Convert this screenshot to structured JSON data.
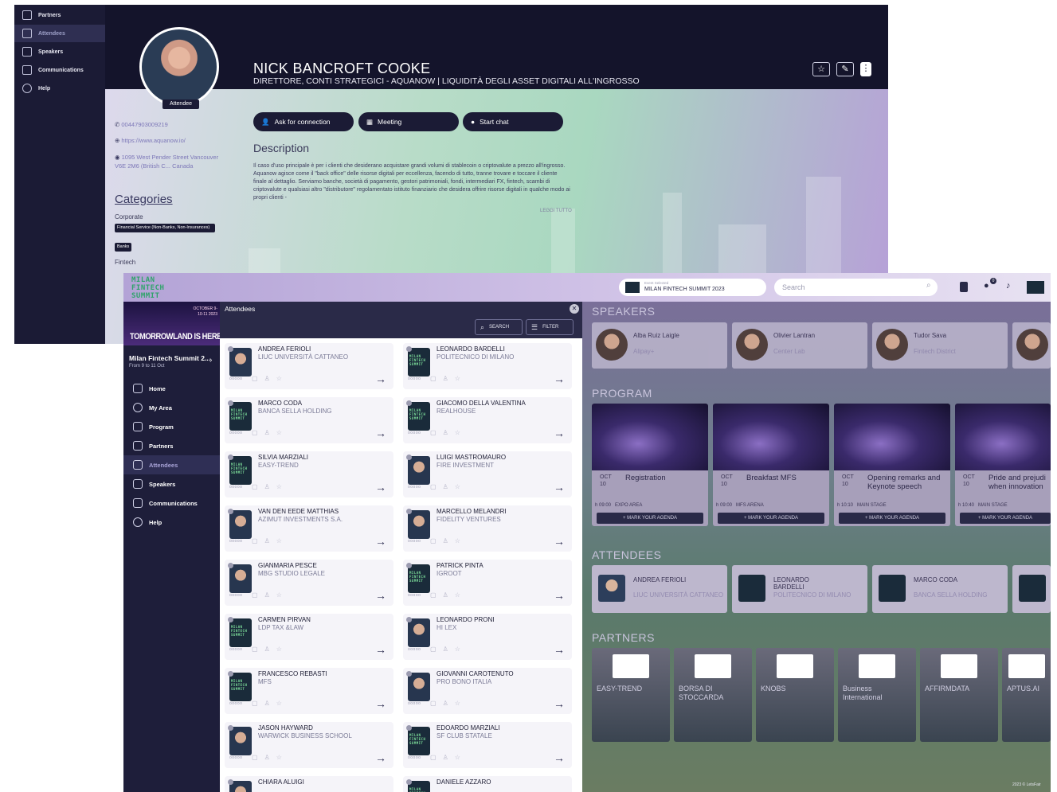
{
  "back_window": {
    "sidebar": [
      {
        "label": "Partners",
        "icon": "partners-icon"
      },
      {
        "label": "Attendees",
        "icon": "attendees-icon",
        "active": true
      },
      {
        "label": "Speakers",
        "icon": "speakers-icon"
      },
      {
        "label": "Communications",
        "icon": "communications-icon"
      },
      {
        "label": "Help",
        "icon": "help-icon"
      }
    ],
    "profile": {
      "badge": "Attendee",
      "name": "NICK BANCROFT COOKE",
      "role": "DIRETTORE, CONTI STRATEGICI - AQUANOW | LIQUIDITÀ DEGLI ASSET DIGITALI ALL'INGROSSO",
      "phone": "00447903009219",
      "website": "https://www.aquanow.io/",
      "address": "1095 West Pender Street Vancouver V6E 2M6 (British C... Canada",
      "categories_title": "Categories",
      "cat1_label": "Corporate",
      "cat1_chips": [
        "Financial Service (Non-Banks, Non-Insurances)",
        "Banks"
      ],
      "cat2_label": "Fintech",
      "actions": [
        "Ask for connection",
        "Meeting",
        "Start chat"
      ],
      "description_title": "Description",
      "description": "Il caso d'uso principale è per i clienti che desiderano acquistare grandi volumi di stablecoin o criptovalute a prezzo all'ingrosso. Aquanow agisce come il \"back office\" delle risorse digitali per eccellenza, facendo di tutto, tranne trovare e toccare il cliente finale al dettaglio. Serviamo banche, società di pagamento, gestori patrimoniali, fondi, intermediari FX, fintech, scambi di criptovalute e qualsiasi altro \"distributore\" regolamentato istituto finanziario che desidera offrire risorse digitali in qualche modo ai propri clienti -",
      "read_all": "LEGGI TUTTO"
    }
  },
  "front_window": {
    "logo_text": "MILAN FINTECH SUMMIT",
    "event_selector_small": "Event Selected",
    "event_selector": "MILAN FINTECH SUMMIT 2023",
    "search_placeholder": "Search",
    "notif_count": "0",
    "banner_tagline": "TOMORROWLAND IS HERE",
    "banner_date": "OCTOBER 9-10-11 2023",
    "event_name": "Milan Fintech Summit 2...",
    "event_dates": "From 9 to 11 Oct",
    "nav": [
      {
        "label": "Home",
        "icon": "home-icon"
      },
      {
        "label": "My Area",
        "icon": "user-icon"
      },
      {
        "label": "Program",
        "icon": "calendar-icon"
      },
      {
        "label": "Partners",
        "icon": "partners-icon"
      },
      {
        "label": "Attendees",
        "icon": "attendees-icon",
        "active": true
      },
      {
        "label": "Speakers",
        "icon": "speakers-icon"
      },
      {
        "label": "Communications",
        "icon": "communications-icon"
      },
      {
        "label": "Help",
        "icon": "help-icon"
      }
    ],
    "panel": {
      "title": "Attendees",
      "search_label": "SEARCH",
      "filter_label": "FILTER",
      "attendees": [
        {
          "name": "ANDREA FERIOLI",
          "company": "LIUC UNIVERSITÀ CATTANEO",
          "avatar": "photo"
        },
        {
          "name": "LEONARDO BARDELLI",
          "company": "POLITECNICO DI MILANO",
          "avatar": "logo"
        },
        {
          "name": "MARCO CODA",
          "company": "BANCA SELLA HOLDING",
          "avatar": "logo"
        },
        {
          "name": "GIACOMO DELLA VALENTINA",
          "company": "REALHOUSE",
          "avatar": "logo"
        },
        {
          "name": "SILVIA MARZIALI",
          "company": "EASY-TREND",
          "avatar": "logo"
        },
        {
          "name": "LUIGI MASTROMAURO",
          "company": "FIRE INVESTMENT",
          "avatar": "photo"
        },
        {
          "name": "VAN DEN EEDE MATTHIAS",
          "company": "AZIMUT INVESTMENTS S.A.",
          "avatar": "photo"
        },
        {
          "name": "MARCELLO MELANDRI",
          "company": "FIDELITY VENTURES",
          "avatar": "photo"
        },
        {
          "name": "GIANMARIA PESCE",
          "company": "MBG STUDIO LEGALE",
          "avatar": "photo"
        },
        {
          "name": "PATRICK PINTA",
          "company": "IGROOT",
          "avatar": "logo"
        },
        {
          "name": "CARMEN PIRVAN",
          "company": "LDP TAX &LAW",
          "avatar": "logo"
        },
        {
          "name": "LEONARDO PRONI",
          "company": "HI LEX",
          "avatar": "photo"
        },
        {
          "name": "FRANCESCO REBASTI",
          "company": "MFS",
          "avatar": "logo"
        },
        {
          "name": "GIOVANNI CAROTENUTO",
          "company": "PRO BONO ITALIA",
          "avatar": "photo"
        },
        {
          "name": "JASON HAYWARD",
          "company": "WARWICK BUSINESS SCHOOL",
          "avatar": "photo"
        },
        {
          "name": "EDOARDO MARZIALI",
          "company": "SF CLUB STATALE",
          "avatar": "logo"
        },
        {
          "name": "CHIARA ALUIGI",
          "company": "",
          "avatar": "photo"
        },
        {
          "name": "DANIELE AZZARO",
          "company": "",
          "avatar": "logo"
        }
      ],
      "rating_text": "ooooo"
    },
    "sections": {
      "speakers_title": "SPEAKERS",
      "speakers": [
        {
          "name": "Alba Ruiz Laigle",
          "company": "Alipay+"
        },
        {
          "name": "Olivier Lantran",
          "company": "Center Lab"
        },
        {
          "name": "Tudor Sava",
          "company": "Fintech District"
        }
      ],
      "program_title": "PROGRAM",
      "program": [
        {
          "month": "OCT",
          "day": "10",
          "title": "Registration",
          "time": "h 09:00",
          "room": "EXPO AREA"
        },
        {
          "month": "OCT",
          "day": "10",
          "title": "Breakfast MFS",
          "time": "h 09:00",
          "room": "MFS ARENA"
        },
        {
          "month": "OCT",
          "day": "10",
          "title": "Opening remarks and Keynote speech",
          "time": "h 10:10",
          "room": "MAIN STAGE"
        },
        {
          "month": "OCT",
          "day": "10",
          "title": "Pride and prejudi when innovation",
          "time": "h 10:40",
          "room": "MAIN STAGE"
        }
      ],
      "mark_label": "+ MARK YOUR AGENDA",
      "attendees_title": "ATTENDEES",
      "attendees": [
        {
          "name": "ANDREA FERIOLI",
          "company": "LIUC UNIVERSITÀ CATTANEO"
        },
        {
          "name": "LEONARDO BARDELLI",
          "company": "POLITECNICO DI MILANO"
        },
        {
          "name": "MARCO CODA",
          "company": "BANCA SELLA HOLDING"
        }
      ],
      "partners_title": "PARTNERS",
      "partners": [
        "EASY-TREND",
        "BORSA DI STOCCARDA",
        "KNOBS",
        "Business International",
        "AFFIRMDATA",
        "APTUS.AI"
      ],
      "footer": "2023 © LetsFair"
    }
  },
  "colors": {
    "sidebar": "#1e1e3a",
    "accent": "#7dde9a",
    "panel_head": "#2a2a48"
  }
}
